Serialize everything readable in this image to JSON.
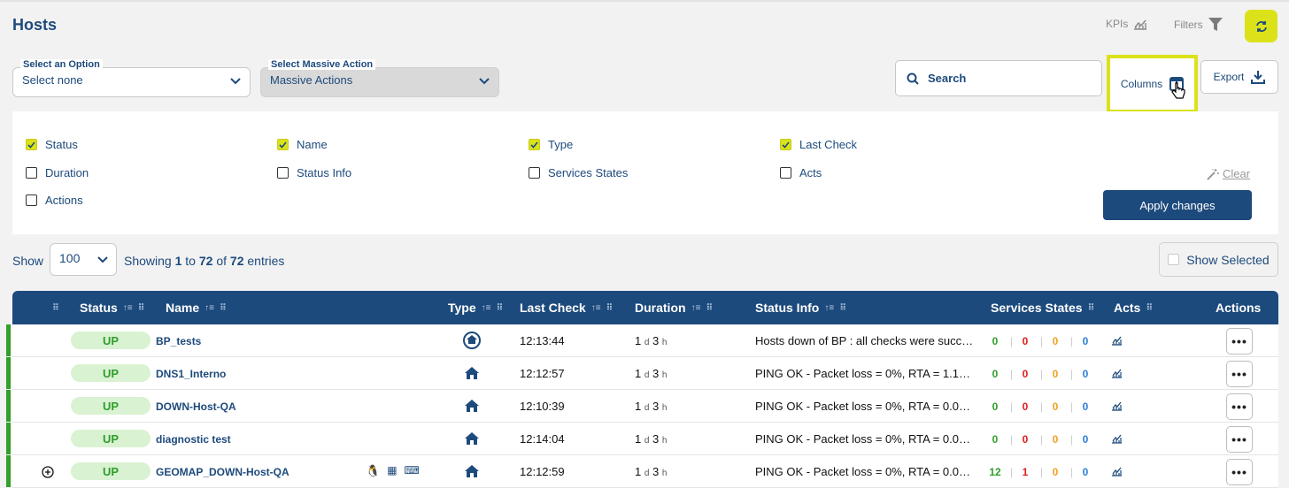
{
  "page": {
    "title": "Hosts"
  },
  "toolbar": {
    "kpis_label": "KPIs",
    "filters_label": "Filters",
    "option_label": "Select an Option",
    "option_value": "Select none",
    "massive_label": "Select Massive Action",
    "massive_value": "Massive Actions",
    "search_label": "Search",
    "columns_label": "Columns",
    "export_label": "Export"
  },
  "columns_panel": {
    "items": [
      {
        "label": "Status",
        "checked": true
      },
      {
        "label": "Name",
        "checked": true
      },
      {
        "label": "Type",
        "checked": true
      },
      {
        "label": "Last Check",
        "checked": true
      },
      {
        "label": "Duration",
        "checked": false
      },
      {
        "label": "Status Info",
        "checked": false
      },
      {
        "label": "Services States",
        "checked": false
      },
      {
        "label": "Acts",
        "checked": false
      },
      {
        "label": "Actions",
        "checked": false
      }
    ],
    "clear_label": "Clear",
    "apply_label": "Apply changes"
  },
  "pagination": {
    "show_label": "Show",
    "page_size": "100",
    "showing_prefix": "Showing",
    "from": "1",
    "to_word": "to",
    "to": "72",
    "of_word": "of",
    "total": "72",
    "entries_word": "entries",
    "show_selected_label": "Show Selected"
  },
  "table": {
    "headers": {
      "status": "Status",
      "name": "Name",
      "type": "Type",
      "last_check": "Last Check",
      "duration": "Duration",
      "status_info": "Status Info",
      "services_states": "Services States",
      "acts": "Acts",
      "actions": "Actions"
    },
    "rows": [
      {
        "status": "UP",
        "name": "BP_tests",
        "type_icon": "home-circle-icon",
        "last_check": "12:13:44",
        "dur_d": "1",
        "dur_h": "3",
        "info": "Hosts down of BP : all checks were succ…",
        "ok": "0",
        "crit": "0",
        "warn": "0",
        "unk": "0",
        "expand": false,
        "extra_icons": false
      },
      {
        "status": "UP",
        "name": "DNS1_Interno",
        "type_icon": "home-icon",
        "last_check": "12:12:57",
        "dur_d": "1",
        "dur_h": "3",
        "info": "PING OK - Packet loss = 0%, RTA = 1.1…",
        "ok": "0",
        "crit": "0",
        "warn": "0",
        "unk": "0",
        "expand": false,
        "extra_icons": false
      },
      {
        "status": "UP",
        "name": "DOWN-Host-QA",
        "type_icon": "home-icon",
        "last_check": "12:10:39",
        "dur_d": "1",
        "dur_h": "3",
        "info": "PING OK - Packet loss = 0%, RTA = 0.0…",
        "ok": "0",
        "crit": "0",
        "warn": "0",
        "unk": "0",
        "expand": false,
        "extra_icons": false
      },
      {
        "status": "UP",
        "name": "diagnostic test",
        "type_icon": "home-icon",
        "last_check": "12:14:04",
        "dur_d": "1",
        "dur_h": "3",
        "info": "PING OK - Packet loss = 0%, RTA = 0.0…",
        "ok": "0",
        "crit": "0",
        "warn": "0",
        "unk": "0",
        "expand": false,
        "extra_icons": false
      },
      {
        "status": "UP",
        "name": "GEOMAP_DOWN-Host-QA",
        "type_icon": "home-icon",
        "last_check": "12:12:59",
        "dur_d": "1",
        "dur_h": "3",
        "info": "PING OK - Packet loss = 0%, RTA = 0.0…",
        "ok": "12",
        "crit": "1",
        "warn": "0",
        "unk": "0",
        "expand": true,
        "extra_icons": true
      }
    ],
    "duration_d_unit": "d",
    "duration_h_unit": "h"
  },
  "colors": {
    "primary": "#1d4a7c",
    "accent": "#dbe21a",
    "ok": "#2e9e2a",
    "critical": "#e01b1b",
    "warning": "#f0a020",
    "unknown": "#2a7fd6"
  }
}
